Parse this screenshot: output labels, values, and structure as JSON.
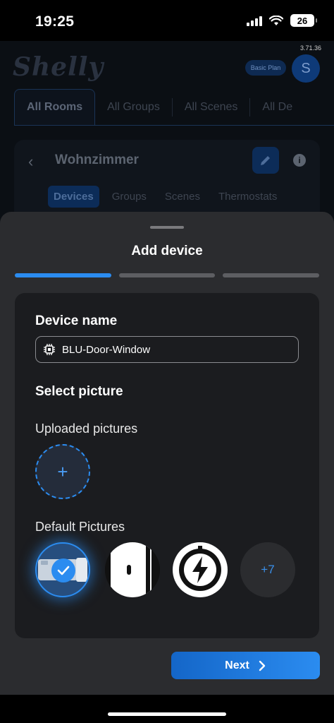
{
  "status_bar": {
    "time": "19:25",
    "battery": "26"
  },
  "app": {
    "version": "3.71.36",
    "logo_text": "Shelly",
    "plan_badge": "Basic Plan",
    "avatar_initial": "S",
    "room_tabs": [
      "All Rooms",
      "All Groups",
      "All Scenes",
      "All De"
    ],
    "room": {
      "title": "Wohnzimmer",
      "sub_tabs": [
        "Devices",
        "Groups",
        "Scenes",
        "Thermostats"
      ]
    }
  },
  "sheet": {
    "title": "Add device",
    "steps_total": 3,
    "current_step": 1,
    "device_name_label": "Device name",
    "device_name_value": "BLU-Door-Window",
    "select_picture_label": "Select picture",
    "uploaded_pictures_label": "Uploaded pictures",
    "upload_plus": "+",
    "default_pictures_label": "Default Pictures",
    "more_count": "+7",
    "next_label": "Next"
  },
  "colors": {
    "accent": "#2b8cf0",
    "sheet_bg": "#2b2c2f",
    "card_bg": "#1b1c1f"
  }
}
